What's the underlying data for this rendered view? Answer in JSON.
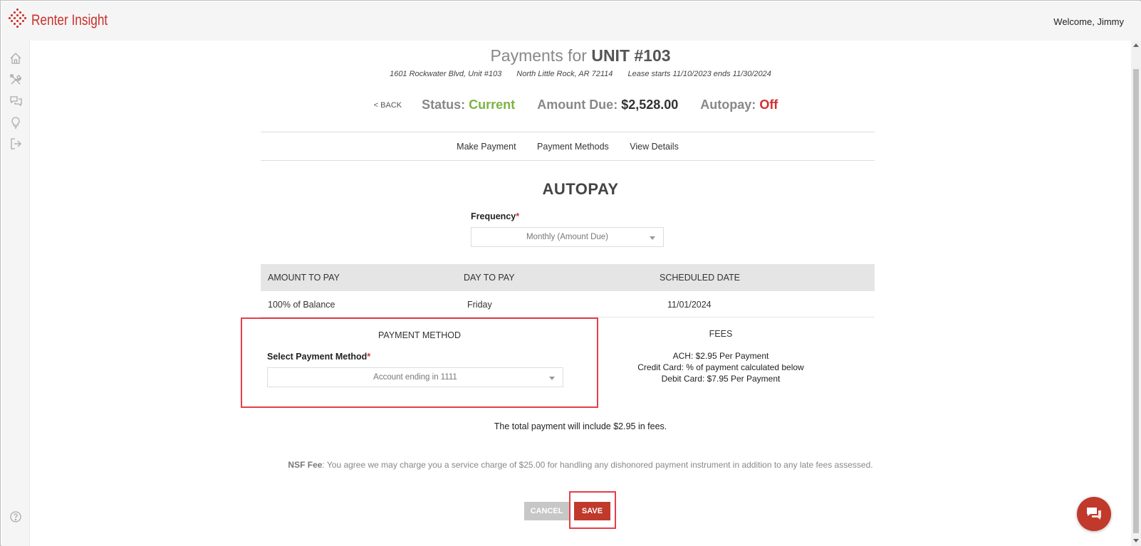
{
  "header": {
    "brand": "Renter Insight",
    "welcome": "Welcome, Jimmy"
  },
  "sidebar": {
    "items": [
      "home-icon",
      "tools-icon",
      "chat-icon",
      "lightbulb-icon",
      "logout-icon"
    ],
    "help": "help-icon"
  },
  "page": {
    "title_prefix": "Payments for",
    "title_unit": "UNIT #103",
    "address": "1601 Rockwater Blvd, Unit #103",
    "city": "North Little Rock, AR 72114",
    "lease": "Lease starts 11/10/2023 ends 11/30/2024"
  },
  "status": {
    "back": "< BACK",
    "status_label": "Status:",
    "status_value": "Current",
    "amount_label": "Amount Due:",
    "amount_value": "$2,528.00",
    "autopay_label": "Autopay:",
    "autopay_value": "Off"
  },
  "tabs": [
    "Make Payment",
    "Payment Methods",
    "View Details"
  ],
  "autopay": {
    "heading": "AUTOPAY",
    "frequency_label": "Frequency",
    "frequency_value": "Monthly (Amount Due)"
  },
  "table": {
    "headers": [
      "AMOUNT TO PAY",
      "DAY TO PAY",
      "SCHEDULED DATE"
    ],
    "row": [
      "100% of Balance",
      "Friday",
      "11/01/2024"
    ]
  },
  "payment_method": {
    "title": "PAYMENT METHOD",
    "label": "Select Payment Method",
    "value": "Account ending in 1111"
  },
  "fees": {
    "title": "FEES",
    "lines": [
      "ACH: $2.95 Per Payment",
      "Credit Card: % of payment calculated below",
      "Debit Card: $7.95 Per Payment"
    ]
  },
  "notes": {
    "total": "The total payment will include $2.95 in fees.",
    "nsf_label": "NSF Fee",
    "nsf_text": ": You agree we may charge you a service charge of $25.00 for handling any dishonored payment instrument in addition to any late fees assessed."
  },
  "buttons": {
    "cancel": "CANCEL",
    "save": "SAVE"
  },
  "colors": {
    "brand": "#c9302c",
    "status_current": "#7cb342",
    "autopay_off": "#d32f2f",
    "highlight": "#e53e4a",
    "save_button": "#c0392b"
  }
}
